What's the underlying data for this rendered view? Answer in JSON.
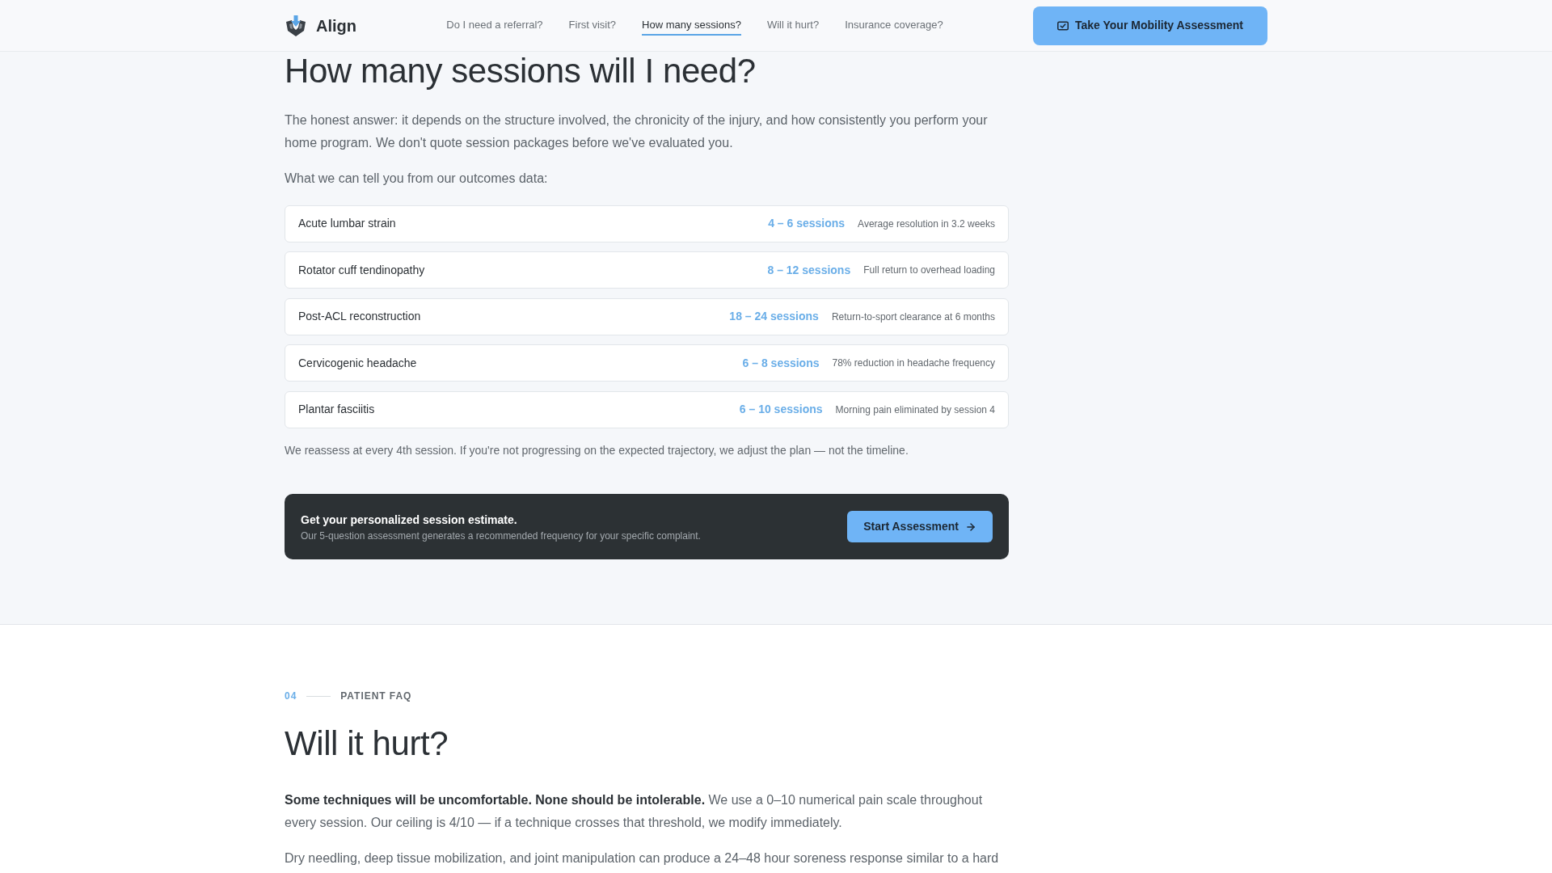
{
  "header": {
    "brand": "Align",
    "nav": [
      {
        "label": "Do I need a referral?",
        "selected": false
      },
      {
        "label": "First visit?",
        "selected": false
      },
      {
        "label": "How many sessions?",
        "selected": true
      },
      {
        "label": "Will it hurt?",
        "selected": false
      },
      {
        "label": "Insurance coverage?",
        "selected": false
      }
    ],
    "cta_button": "Take Your Mobility Assessment"
  },
  "sessions_section": {
    "heading": "How many sessions will I need?",
    "paragraphs": [
      "The honest answer: it depends on the structure involved, the chronicity of the injury, and how consistently you perform your home program. We don't quote session packages before we've evaluated you.",
      "What we can tell you from our outcomes data:"
    ],
    "outcomes": [
      {
        "condition": "Acute lumbar strain",
        "sessions": "4 – 6 sessions",
        "result": "Average resolution in 3.2 weeks"
      },
      {
        "condition": "Rotator cuff tendinopathy",
        "sessions": "8 – 12 sessions",
        "result": "Full return to overhead loading"
      },
      {
        "condition": "Post-ACL reconstruction",
        "sessions": "18 – 24 sessions",
        "result": "Return-to-sport clearance at 6 months"
      },
      {
        "condition": "Cervicogenic headache",
        "sessions": "6 – 8 sessions",
        "result": "78% reduction in headache frequency"
      },
      {
        "condition": "Plantar fasciitis",
        "sessions": "6 – 10 sessions",
        "result": "Morning pain eliminated by session 4"
      }
    ],
    "note": "We reassess at every 4th session. If you're not progressing on the expected trajectory, we adjust the plan — not the timeline.",
    "estimate_banner": {
      "title": "Get your personalized session estimate.",
      "subtitle": "Our 5-question assessment generates a recommended frequency for your specific complaint.",
      "button": "Start Assessment"
    }
  },
  "faq_section": {
    "number": "04",
    "eyebrow": "PATIENT FAQ",
    "heading": "Will it hurt?",
    "paragraphs": [
      "**Some techniques will be uncomfortable. None should be intolerable.** We use a 0–10 numerical pain scale throughout every session. Our ceiling is 4/10 — if a technique crosses that threshold, we modify immediately.",
      "Dry needling, deep tissue mobilization, and joint manipulation can produce a 24–48 hour soreness response similar to a hard"
    ]
  }
}
